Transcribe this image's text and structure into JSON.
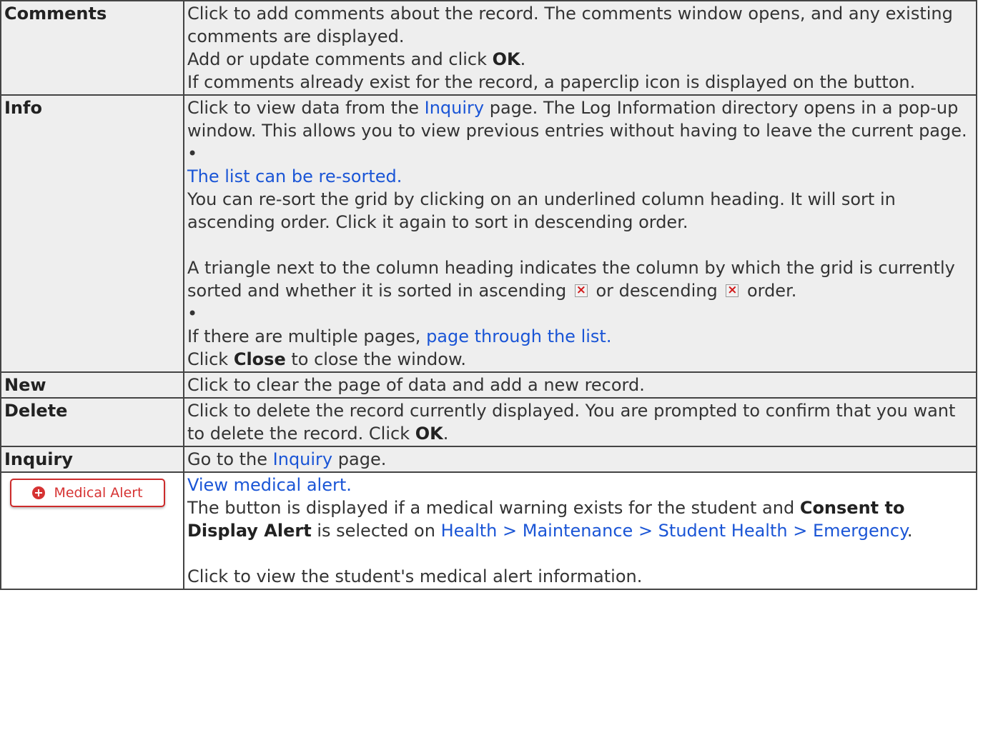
{
  "rows": {
    "comments": {
      "label": "Comments",
      "line1": "Click to add comments about the record. The comments window opens, and any existing comments are displayed.",
      "line2_pre": "Add or update comments and click ",
      "line2_bold": "OK",
      "line2_post": ".",
      "line3": "If comments already exist for the record, a paperclip icon is displayed on the button."
    },
    "info": {
      "label": "Info",
      "p1_pre": "Click to view data from the ",
      "p1_link": "Inquiry",
      "p1_post": " page. The Log Information directory opens in a pop-up window. This allows you to view previous entries without having to leave the current page.",
      "bullet1": "•",
      "resort_link": "The list can be re-sorted.",
      "resort_text": "You can re-sort the grid by clicking on an underlined column heading. It will sort in ascending order. Click it again to sort in descending order.",
      "triangle_pre": "A triangle next to the column heading indicates the column by which the grid is currently sorted and whether it is sorted in ascending ",
      "triangle_mid": " or descending ",
      "triangle_post": " order.",
      "bullet2": "•",
      "pages_pre": "If there are multiple pages, ",
      "pages_link": "page through the list.",
      "close_pre": "Click ",
      "close_bold": "Close",
      "close_post": " to close the window."
    },
    "new": {
      "label": "New",
      "text": "Click to clear the page of data and add a new record."
    },
    "delete": {
      "label": "Delete",
      "text_pre": "Click to delete the record currently displayed. You are prompted to confirm that you want to delete the record. Click ",
      "text_bold": "OK",
      "text_post": "."
    },
    "inquiry": {
      "label": "Inquiry",
      "text_pre": "Go to the ",
      "text_link": "Inquiry",
      "text_post": " page."
    },
    "medical": {
      "button_label": "Medical Alert",
      "link": "View medical alert.",
      "p1_pre": "The button is displayed if a medical warning exists for the student and ",
      "p1_bold": "Consent to Display Alert",
      "p1_mid": " is selected on ",
      "p1_link": "Health > Maintenance > Student Health > Emergency",
      "p1_post": ".",
      "p2": "Click to view the student's medical alert information."
    }
  },
  "colors": {
    "link": "#1a55d6",
    "row_gray": "#eeeeee",
    "alert_red": "#d63333"
  },
  "icons": {
    "sort_ascending": "broken-image-icon",
    "sort_descending": "broken-image-icon",
    "medical_alert": "plus-circle-icon"
  }
}
